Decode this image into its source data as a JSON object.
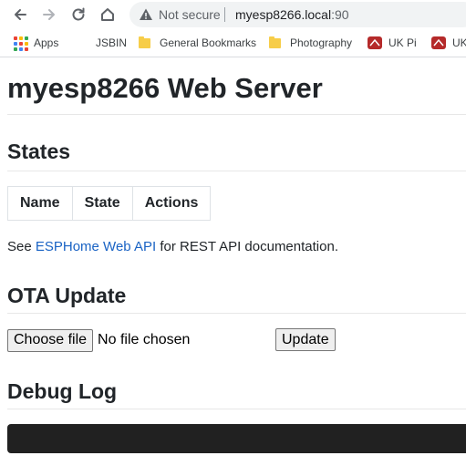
{
  "browser": {
    "security_label": "Not secure",
    "url_host": "myesp8266.local",
    "url_port": ":90",
    "bookmarks": [
      {
        "label": "Apps",
        "icon": "apps-grid-icon"
      },
      {
        "label": "JSBIN",
        "icon": "jsbin-icon"
      },
      {
        "label": "General Bookmarks",
        "icon": "folder-icon"
      },
      {
        "label": "Photography",
        "icon": "folder-icon"
      },
      {
        "label": "UK Pi",
        "icon": "raspberry-pi-icon"
      },
      {
        "label": "UK",
        "icon": "raspberry-pi-icon"
      }
    ]
  },
  "page": {
    "title": "myesp8266 Web Server",
    "states_heading": "States",
    "table_headers": [
      "Name",
      "State",
      "Actions"
    ],
    "doc_prefix": "See ",
    "doc_link": "ESPHome Web API",
    "doc_suffix": " for REST API documentation.",
    "ota_heading": "OTA Update",
    "choose_file_label": "Choose file",
    "no_file_text": "No file chosen",
    "update_label": "Update",
    "debug_heading": "Debug Log"
  },
  "colors": {
    "link": "#1a63c4",
    "log_background": "#212121",
    "rule": "#e7e7e7"
  }
}
